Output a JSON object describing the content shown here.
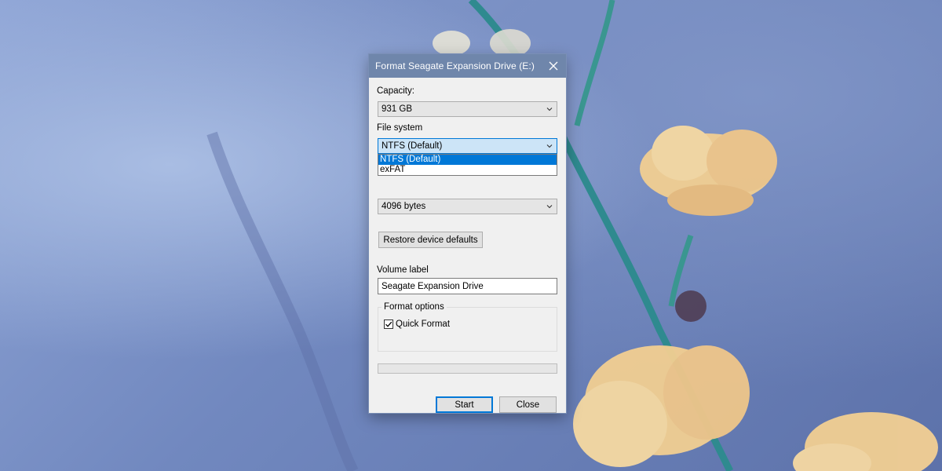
{
  "window": {
    "title": "Format Seagate Expansion Drive (E:)",
    "close_icon": "close-icon"
  },
  "capacity": {
    "label": "Capacity:",
    "value": "931 GB"
  },
  "file_system": {
    "label": "File system",
    "value": "NTFS (Default)",
    "options": [
      "NTFS (Default)",
      "exFAT"
    ],
    "selected_index": 0,
    "expanded": true
  },
  "allocation_unit": {
    "value": "4096 bytes"
  },
  "restore_defaults": {
    "label": "Restore device defaults"
  },
  "volume_label": {
    "label": "Volume label",
    "value": "Seagate Expansion Drive"
  },
  "format_options": {
    "legend": "Format options",
    "quick_format_label": "Quick Format",
    "quick_format_checked": true
  },
  "progress": {
    "fraction": 0
  },
  "buttons": {
    "start": "Start",
    "close": "Close"
  },
  "colors": {
    "titlebar": "#6f86ab",
    "accent": "#0078d7",
    "dialog_bg": "#f0f0f0"
  }
}
